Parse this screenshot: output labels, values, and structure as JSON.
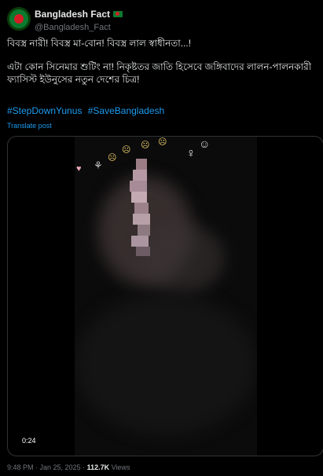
{
  "post": {
    "display_name": "Bangladesh Fact",
    "handle": "@Bangladesh_Fact",
    "flag_icon": "bangladesh-flag-icon",
    "text_line1": "বিবস্ত্র নারী! বিবস্ত্র মা-বোন! বিবস্ত্র লাল স্বাধীনতা...!",
    "text_line2": "এটা কোন সিনেমার শুটিং না! নিকৃষ্টতর জাতি হিসেবে জঙ্গিবাদের লালন-পালনকারী ফ্যাসিস্ট ইউনুসের নতুন দেশের চিত্র!",
    "hashtags": [
      "#StepDownYunus",
      "#SaveBangladesh"
    ],
    "translate_label": "Translate post",
    "video_duration": "0:24",
    "timestamp": "9:48 PM · Jan 25, 2025 · ",
    "views_count": "112.7K",
    "views_label": " Views"
  },
  "colors": {
    "background": "#000000",
    "text": "#e7e9ea",
    "muted": "#71767b",
    "link": "#1d9bf0",
    "border": "#2f3336"
  }
}
